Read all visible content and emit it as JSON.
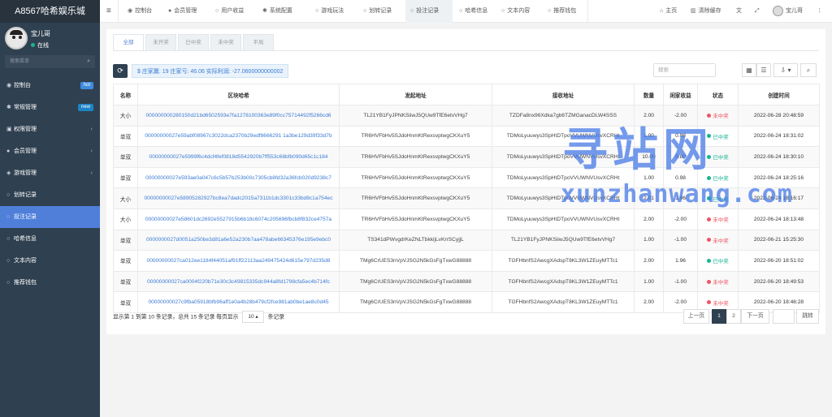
{
  "brand": "A8567哈希娱乐城",
  "user": {
    "name": "宝儿哥",
    "status": "在线"
  },
  "sidebar_search_placeholder": "搜索菜单",
  "sidebar": [
    {
      "icon": "dashboard-icon",
      "glyph": "◉",
      "label": "控制台",
      "badge": "hot",
      "badge_color": "#3f8be0"
    },
    {
      "icon": "gear-icon",
      "glyph": "✱",
      "label": "常规管理",
      "badge": "new",
      "badge_color": "#1c84c6"
    },
    {
      "icon": "lock-icon",
      "glyph": "▣",
      "label": "权限管理",
      "chevron": "‹"
    },
    {
      "icon": "user-icon",
      "glyph": "●",
      "label": "会员管理",
      "chevron": "‹"
    },
    {
      "icon": "game-icon",
      "glyph": "◈",
      "label": "游戏管理",
      "chevron": "‹"
    },
    {
      "icon": "circle-icon",
      "glyph": "○",
      "label": "划转记录"
    },
    {
      "icon": "circle-icon",
      "glyph": "○",
      "label": "投注记录",
      "active": true
    },
    {
      "icon": "circle-icon",
      "glyph": "○",
      "label": "哈希信息"
    },
    {
      "icon": "circle-icon",
      "glyph": "○",
      "label": "文本内容"
    },
    {
      "icon": "circle-icon",
      "glyph": "○",
      "label": "推荐钱包"
    }
  ],
  "topbar": {
    "menu_glyph": "≡",
    "tabs": [
      {
        "glyph": "◉",
        "label": "控制台"
      },
      {
        "glyph": "●",
        "label": "会员管理"
      },
      {
        "glyph": "○",
        "label": "用户收益"
      },
      {
        "glyph": "✱",
        "label": "系统配置"
      },
      {
        "glyph": "○",
        "label": "游戏玩法"
      },
      {
        "glyph": "○",
        "label": "划转记录"
      },
      {
        "glyph": "○",
        "label": "投注记录",
        "active": true
      },
      {
        "glyph": "○",
        "label": "哈希信息"
      },
      {
        "glyph": "○",
        "label": "文本内容"
      },
      {
        "glyph": "○",
        "label": "推荐钱包"
      }
    ],
    "home": "主页",
    "clear_cache": "清除缓存",
    "username": "宝儿哥"
  },
  "filter_tabs": [
    "全部",
    "未开奖",
    "已中奖",
    "未中奖",
    "平局"
  ],
  "summary": "$ 庄家赢: 19 庄家亏: 46.06 实际利润: -27.0600000000002",
  "search_placeholder": "搜索",
  "table": {
    "headers": [
      "名称",
      "区块哈希",
      "发起地址",
      "接收地址",
      "数量",
      "闲家收益",
      "状态",
      "创建时间"
    ],
    "rows": [
      {
        "name": "大小",
        "hash": "000000000280150d21bd6502593e7fa1278100363e89f0cc75714492f5266cd6",
        "from": "TL21YB1FyJPNKSiiwJ5QUw9TfE6etvVHg7",
        "to": "TZDFa8nx96Xdka7gb6TZMGanacDLW4SSS",
        "amount": "2.00",
        "profit": "-2.00",
        "status": "未中奖",
        "win": false,
        "time": "2022-06-28 20:48:59"
      },
      {
        "name": "单双",
        "hash": "00000000027e59abf08967c3022dca2370b29edf8666291 1a3be129d39f33d7b",
        "from": "TR6HVFbHv5SJdoHnmKtRexsvptwgCKXuY5",
        "to": "TDMoLyuuwys3SpHtDTpoVVUWNVUsvXCRHt",
        "amount": "1.00",
        "profit": "0.98",
        "status": "已中奖",
        "win": true,
        "time": "2022-06-24 18:31:02"
      },
      {
        "name": "单双",
        "hash": "00000000027e5999f6c4dcf4fef0818d5542920b7ff553c68bfb090d65c1c184",
        "from": "TR6HVFbHv5SJdoHnmKtRexsvptwgCKXuY5",
        "to": "TDMoLyuuwys3SpHtDTpoVVUWNVUsvXCRHt",
        "amount": "10.00",
        "profit": "9.80",
        "status": "已中奖",
        "win": true,
        "time": "2022-06-24 18:30:10"
      },
      {
        "name": "单双",
        "hash": "00000000027e593ae0a047c6c5b57b253b00c7305cb8fd32a36fcb020d9238c7",
        "from": "TR6HVFbHv5SJdoHnmKtRexsvptwgCKXuY5",
        "to": "TDMoLyuuwys3SpHtDTpoVVUWNVUsvXCRHt",
        "amount": "1.00",
        "profit": "0.98",
        "status": "已中奖",
        "win": true,
        "time": "2022-06-24 18:25:16"
      },
      {
        "name": "大小",
        "hash": "00000000027e58905282927bc8ea7dadc2015a7311b1dc3301c33bd8c1a754ec",
        "from": "TR6HVFbHv5SJdoHnmKtRexsvptwgCKXuY5",
        "to": "TDMoLyuuwys3SpHtDTpoVVUWNVUsvXCRHt",
        "amount": "2.01",
        "profit": "1.96",
        "status": "已中奖",
        "win": true,
        "time": "2022-06-24 18:16:17"
      },
      {
        "name": "大小",
        "hash": "00000000027e58601dc2692e5527915b6b18c6074c205696fbcb8f832ce4757a",
        "from": "TR6HVFbHv5SJdoHnmKtRexsvptwgCKXuY5",
        "to": "TDMoLyuuwys3SpHtDTpoVVUWNVUsvXCRHt",
        "amount": "2.00",
        "profit": "-2.00",
        "status": "未中奖",
        "win": false,
        "time": "2022-06-24 18:13:48"
      },
      {
        "name": "单双",
        "hash": "0000000027d0051a250be3d81a6e52a230b7aa478abe66345376e195e9ebc0",
        "from": "TS341dPWvgdrKeZNLTbkkijLvKrrSCyjjL",
        "to": "TL21YB1FyJPNKSiiwJ5QUw9TfE6etvVHg7",
        "amount": "1.00",
        "profit": "-1.00",
        "status": "未中奖",
        "win": false,
        "time": "2022-06-21 15:25:30"
      },
      {
        "name": "单双",
        "hash": "00000000027ca012ee1184f44051af91ff22113aa249475424d615e797d235d8",
        "from": "TMg6CrUES3nVpVJSG2N5kGsFgTxwG88888",
        "to": "TGFHbnfS2AwcgXAdspT8KL3W1ZEuyMTTc1",
        "amount": "2.00",
        "profit": "1.96",
        "status": "已中奖",
        "win": true,
        "time": "2022-06-20 18:51:02"
      },
      {
        "name": "单双",
        "hash": "00000000027ca0004f220b71e30c3c49815335dc944a8fd1798cfa5ec4b714fc",
        "from": "TMg6CrUES3nVpVJSG2N5kGsFgTxwG88888",
        "to": "TGFHbnfS2AwcgXAdspT8KL3W1ZEuyMTTc1",
        "amount": "1.00",
        "profit": "-1.00",
        "status": "未中奖",
        "win": false,
        "time": "2022-06-20 18:49:53"
      },
      {
        "name": "单双",
        "hash": "00000000027c9fba05918bfb96aff1e0a4b28b479cf2fce981ab0be1ae8c0d45",
        "from": "TMg6CrUES3nVpVJSG2N5kGsFgTxwG88888",
        "to": "TGFHbnfS2AwcgXAdspT8KL3W1ZEuyMTTc1",
        "amount": "2.00",
        "profit": "-2.00",
        "status": "未中奖",
        "win": false,
        "time": "2022-06-20 18:46:28"
      }
    ]
  },
  "pagination": {
    "info_prefix": "显示第 1 到第 10 条记录，总共 15 条记录 每页显示",
    "page_size": "10 ▴",
    "info_suffix": "条记录",
    "prev": "上一页",
    "pages": [
      "1",
      "2"
    ],
    "next": "下一页",
    "goto_value": "",
    "jump": "跳转"
  },
  "colors": {
    "sidebar": "#2f4050",
    "active": "#4f7fd9",
    "win": "#1ab394",
    "lose": "#ed5565",
    "link": "#3a7bd5"
  },
  "watermark": {
    "big": "寻站网",
    "small": "xunzhanwang.com"
  }
}
